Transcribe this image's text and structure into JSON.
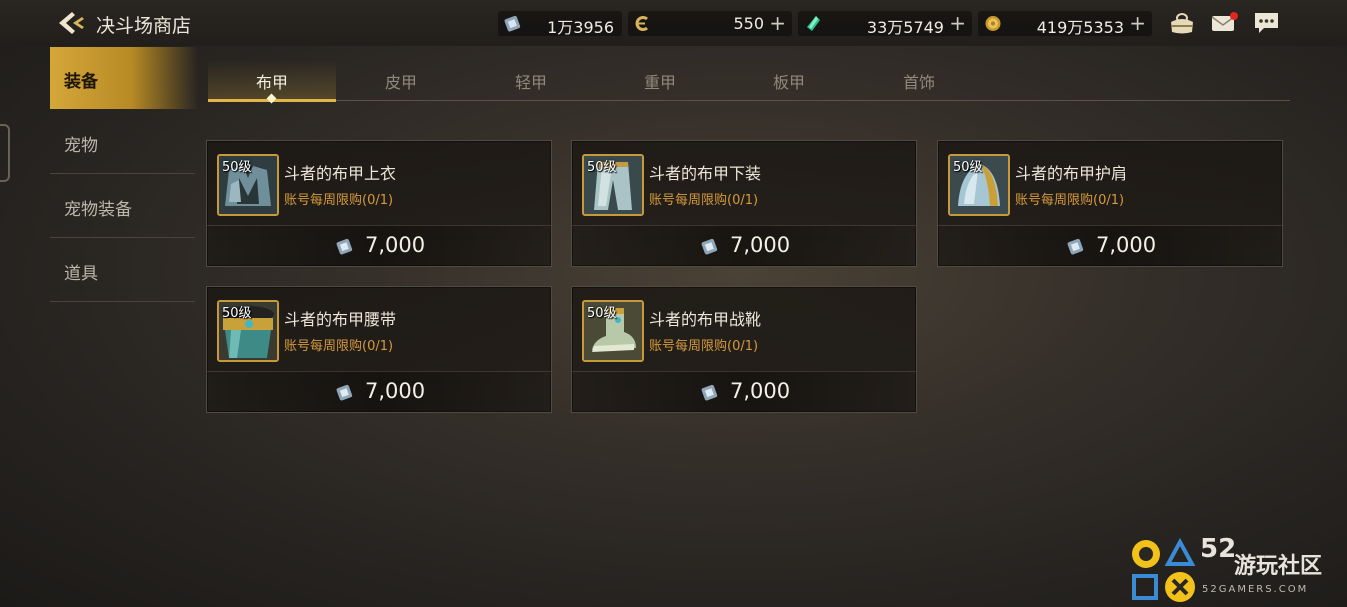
{
  "header": {
    "title": "决斗场商店",
    "currencies": [
      {
        "icon": "crystal-ticket-icon",
        "value": "1万3956",
        "has_plus": false
      },
      {
        "icon": "c-coin-icon",
        "value": "550",
        "has_plus": true
      },
      {
        "icon": "green-gem-icon",
        "value": "33万5749",
        "has_plus": true
      },
      {
        "icon": "gold-coin-icon",
        "value": "419万5353",
        "has_plus": true
      }
    ],
    "plus_symbol": "+"
  },
  "sidebar": {
    "items": [
      {
        "label": "装备",
        "active": true
      },
      {
        "label": "宠物",
        "active": false
      },
      {
        "label": "宠物装备",
        "active": false
      },
      {
        "label": "道具",
        "active": false
      }
    ]
  },
  "tabs": [
    {
      "label": "布甲",
      "active": true
    },
    {
      "label": "皮甲",
      "active": false
    },
    {
      "label": "轻甲",
      "active": false
    },
    {
      "label": "重甲",
      "active": false
    },
    {
      "label": "板甲",
      "active": false
    },
    {
      "label": "首饰",
      "active": false
    }
  ],
  "items": [
    {
      "level": "50级",
      "name": "斗者的布甲上衣",
      "limit": "账号每周限购(0/1)",
      "price": "7,000",
      "icon": "cloth-top-icon"
    },
    {
      "level": "50级",
      "name": "斗者的布甲下装",
      "limit": "账号每周限购(0/1)",
      "price": "7,000",
      "icon": "cloth-pants-icon"
    },
    {
      "level": "50级",
      "name": "斗者的布甲护肩",
      "limit": "账号每周限购(0/1)",
      "price": "7,000",
      "icon": "cloth-shoulder-icon"
    },
    {
      "level": "50级",
      "name": "斗者的布甲腰带",
      "limit": "账号每周限购(0/1)",
      "price": "7,000",
      "icon": "cloth-belt-icon"
    },
    {
      "level": "50级",
      "name": "斗者的布甲战靴",
      "limit": "账号每周限购(0/1)",
      "price": "7,000",
      "icon": "cloth-boots-icon"
    }
  ],
  "watermark": {
    "number": "52",
    "name": "游玩社区",
    "sub": "52GAMERS.COM"
  },
  "colors": {
    "accent_gold": "#e2b44a",
    "limit_orange": "#d59a3c",
    "active_side": "#d4a73a"
  }
}
